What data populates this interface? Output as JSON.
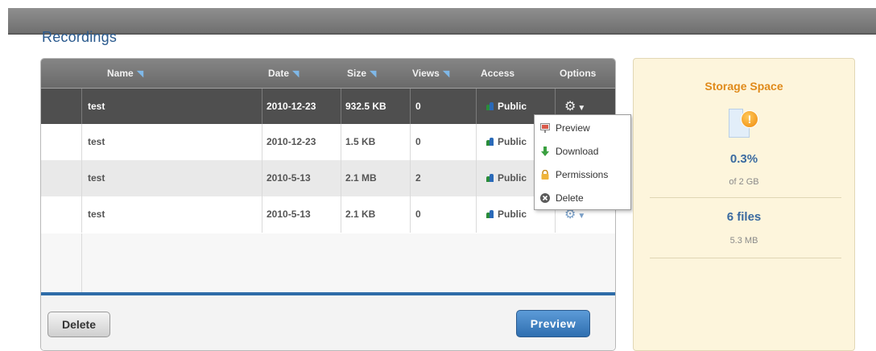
{
  "page": {
    "title": "Recordings"
  },
  "table": {
    "columns": [
      {
        "label": "Name",
        "sortable": true
      },
      {
        "label": "Date",
        "sortable": true
      },
      {
        "label": "Size",
        "sortable": true
      },
      {
        "label": "Views",
        "sortable": true
      },
      {
        "label": "Access",
        "sortable": false
      },
      {
        "label": "Options",
        "sortable": false
      }
    ],
    "sort_icon": "sort-arrow-icon",
    "rows": [
      {
        "name": "test",
        "date": "2010-12-23",
        "size": "932.5 KB",
        "views": "0",
        "access": "Public",
        "selected": true
      },
      {
        "name": "test",
        "date": "2010-12-23",
        "size": "1.5 KB",
        "views": "0",
        "access": "Public",
        "selected": false
      },
      {
        "name": "test",
        "date": "2010-5-13",
        "size": "2.1 MB",
        "views": "2",
        "access": "Public",
        "selected": false
      },
      {
        "name": "test",
        "date": "2010-5-13",
        "size": "2.1 KB",
        "views": "0",
        "access": "Public",
        "selected": false
      }
    ]
  },
  "options_menu": {
    "items": [
      {
        "label": "Preview",
        "icon": "preview-icon"
      },
      {
        "label": "Download",
        "icon": "download-arrow-icon"
      },
      {
        "label": "Permissions",
        "icon": "lock-icon"
      },
      {
        "label": "Delete",
        "icon": "delete-x-icon"
      }
    ]
  },
  "footer": {
    "delete_label": "Delete",
    "preview_label": "Preview"
  },
  "storage": {
    "title": "Storage Space",
    "percent": "0.3%",
    "quota": "of 2 GB",
    "files": "6 files",
    "files_size": "5.3 MB",
    "icons": [
      "document-icon",
      "warning-icon"
    ]
  },
  "colors": {
    "accent": "#2e6ca8",
    "title_blue": "#2a5a8e",
    "storage_title": "#e08a1a",
    "storage_bg": "#fdf5dc"
  }
}
